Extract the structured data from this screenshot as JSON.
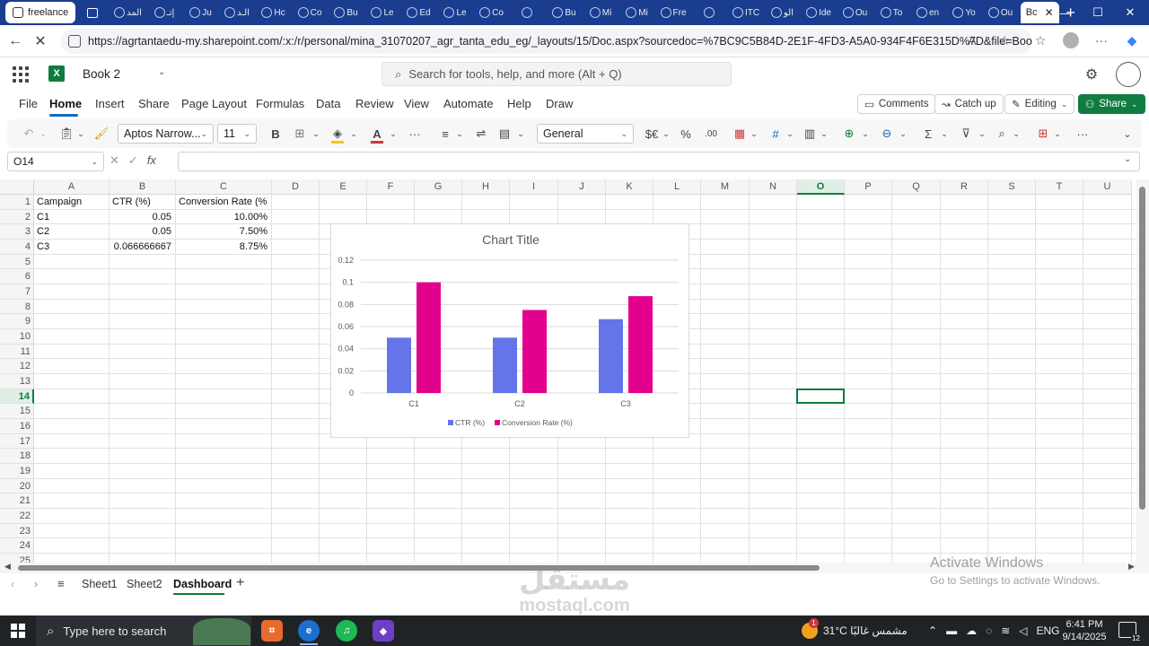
{
  "browser": {
    "first_tab_label": "freelance",
    "mini_tabs": [
      "المد",
      "إتـ",
      "Ju",
      "الـد",
      "Hc",
      "Co",
      "Bu",
      "Le",
      "Ed",
      "Le",
      "Co",
      "",
      "Bu",
      "Mi",
      "Mi",
      "Fre",
      "",
      "ITC",
      "الو",
      "Ide",
      "Ou",
      "To",
      "en",
      "Yo",
      "Ou"
    ],
    "current_tab_label": "Bc",
    "url": "https://agrtantaedu-my.sharepoint.com/:x:/r/personal/mina_31070207_agr_tanta_edu_eg/_layouts/15/Doc.aspx?sourcedoc=%7BC9C5B84D-2E1F-4FD3-A5A0-934F4F6E315D%7D&file=Book%2..."
  },
  "app": {
    "book_name": "Book 2",
    "search_placeholder": "Search for tools, help, and more (Alt + Q)",
    "menu": [
      "File",
      "Home",
      "Insert",
      "Share",
      "Page Layout",
      "Formulas",
      "Data",
      "Review",
      "View",
      "Automate",
      "Help",
      "Draw"
    ],
    "comments_label": "Comments",
    "catchup_label": "Catch up",
    "editing_label": "Editing",
    "share_label": "Share"
  },
  "ribbon": {
    "font_name": "Aptos Narrow...",
    "font_size": "11",
    "number_format": "General",
    "colors": {
      "fill": "#f5c518",
      "font": "#d13438"
    }
  },
  "formula_bar": {
    "name_box": "O14",
    "fx": "fx",
    "value": ""
  },
  "sheet": {
    "columns": [
      "A",
      "B",
      "C",
      "D",
      "E",
      "F",
      "G",
      "H",
      "I",
      "J",
      "K",
      "L",
      "M",
      "N",
      "O",
      "P",
      "Q",
      "R",
      "S",
      "T",
      "U"
    ],
    "rows": [
      "1",
      "2",
      "3",
      "4",
      "5",
      "6",
      "7",
      "8",
      "9",
      "10",
      "11",
      "12",
      "13",
      "14",
      "15",
      "16",
      "17",
      "18",
      "19",
      "20",
      "21",
      "22",
      "23",
      "24",
      "25"
    ],
    "selected_col": "O",
    "selected_row": "14",
    "cells": {
      "A1": "Campaign",
      "B1": "CTR (%)",
      "C1": "Conversion Rate (%)",
      "A2": "C1",
      "B2": "0.05",
      "C2": "10.00%",
      "A3": "C2",
      "B3": "0.05",
      "C3": "7.50%",
      "A4": "C3",
      "B4": "0.066666667",
      "C4": "8.75%"
    }
  },
  "chart_data": {
    "type": "bar",
    "title": "Chart Title",
    "categories": [
      "C1",
      "C2",
      "C3"
    ],
    "series": [
      {
        "name": "CTR (%)",
        "values": [
          0.05,
          0.05,
          0.0667
        ],
        "color": "#6375e8"
      },
      {
        "name": "Conversion Rate (%)",
        "values": [
          0.1,
          0.075,
          0.0875
        ],
        "color": "#e3008c"
      }
    ],
    "yticks": [
      "0",
      "0.02",
      "0.04",
      "0.06",
      "0.08",
      "0.1",
      "0.12"
    ],
    "ylim": [
      0,
      0.12
    ],
    "grid": true,
    "legend": "bottom"
  },
  "sheet_tabs": [
    "Sheet1",
    "Sheet2",
    "Dashboard"
  ],
  "active_sheet": "Dashboard",
  "watermark": {
    "line1": "Activate Windows",
    "line2": "Go to Settings to activate Windows.",
    "brand_ar": "مستقل",
    "brand_en": "mostaql.com"
  },
  "taskbar": {
    "search_text": "Type here to search",
    "weather": "31°C مشمس غالبًا",
    "lang": "ENG",
    "time": "6:41 PM",
    "date": "9/14/2025",
    "notifications": "12",
    "weather_badge": "1"
  }
}
